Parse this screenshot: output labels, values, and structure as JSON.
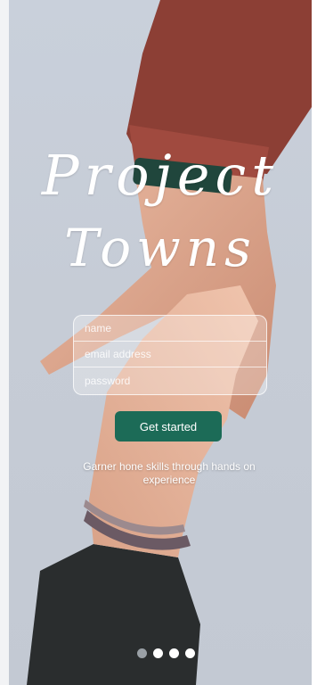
{
  "app": {
    "title_line1": "Project",
    "title_line2": "Towns"
  },
  "form": {
    "name_placeholder": "name",
    "email_placeholder": "email address",
    "password_placeholder": "password"
  },
  "cta": {
    "label": "Get started"
  },
  "tagline": "Garner hone skills through hands on experience",
  "pager": {
    "total": 4,
    "active_index": 0
  },
  "colors": {
    "accent": "#1c6b57",
    "sleeve_top": "#8c3f35",
    "sleeve_bottom": "#2a2d2e",
    "background": "#c8cfd9"
  }
}
